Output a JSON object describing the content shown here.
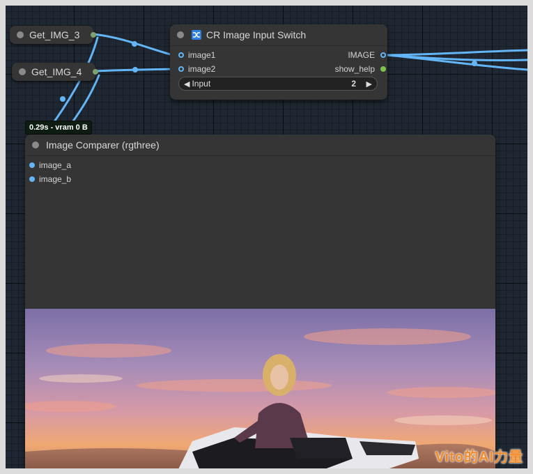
{
  "get_nodes": [
    {
      "label": "Get_IMG_3"
    },
    {
      "label": "Get_IMG_4"
    }
  ],
  "switch_node": {
    "title": "CR Image Input Switch",
    "title_icon": "shuffle-icon",
    "inputs": [
      "image1",
      "image2"
    ],
    "outputs": [
      "IMAGE",
      "show_help"
    ],
    "widget": {
      "name": "Input",
      "value": "2"
    }
  },
  "timing_badge": "0.29s - vram 0 B",
  "comparer_node": {
    "title": "Image Comparer (rgthree)",
    "inputs": [
      "image_a",
      "image_b"
    ]
  },
  "watermark": "Vito的AI力量",
  "colors": {
    "canvas_bg": "#1f2832",
    "node_bg": "#353535",
    "wire_blue": "#64b5f6",
    "slot_green": "#7cc24d",
    "icon_blue": "#2d7fe0"
  }
}
